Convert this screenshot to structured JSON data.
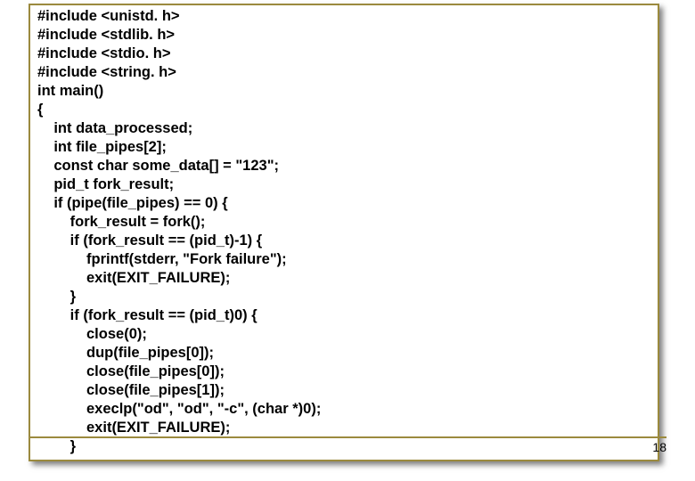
{
  "slide": {
    "page_number": "18",
    "code_lines": [
      "#include <unistd. h>",
      "#include <stdlib. h>",
      "#include <stdio. h>",
      "#include <string. h>",
      "int main()",
      "{",
      "    int data_processed;",
      "    int file_pipes[2];",
      "    const char some_data[] = \"123\";",
      "    pid_t fork_result;",
      "    if (pipe(file_pipes) == 0) {",
      "        fork_result = fork();",
      "        if (fork_result == (pid_t)-1) {",
      "            fprintf(stderr, \"Fork failure\");",
      "            exit(EXIT_FAILURE);",
      "        }",
      "        if (fork_result == (pid_t)0) {",
      "            close(0);",
      "            dup(file_pipes[0]);",
      "            close(file_pipes[0]);",
      "            close(file_pipes[1]);",
      "            execlp(\"od\", \"od\", \"-c\", (char *)0);",
      "            exit(EXIT_FAILURE);",
      "        }"
    ]
  }
}
